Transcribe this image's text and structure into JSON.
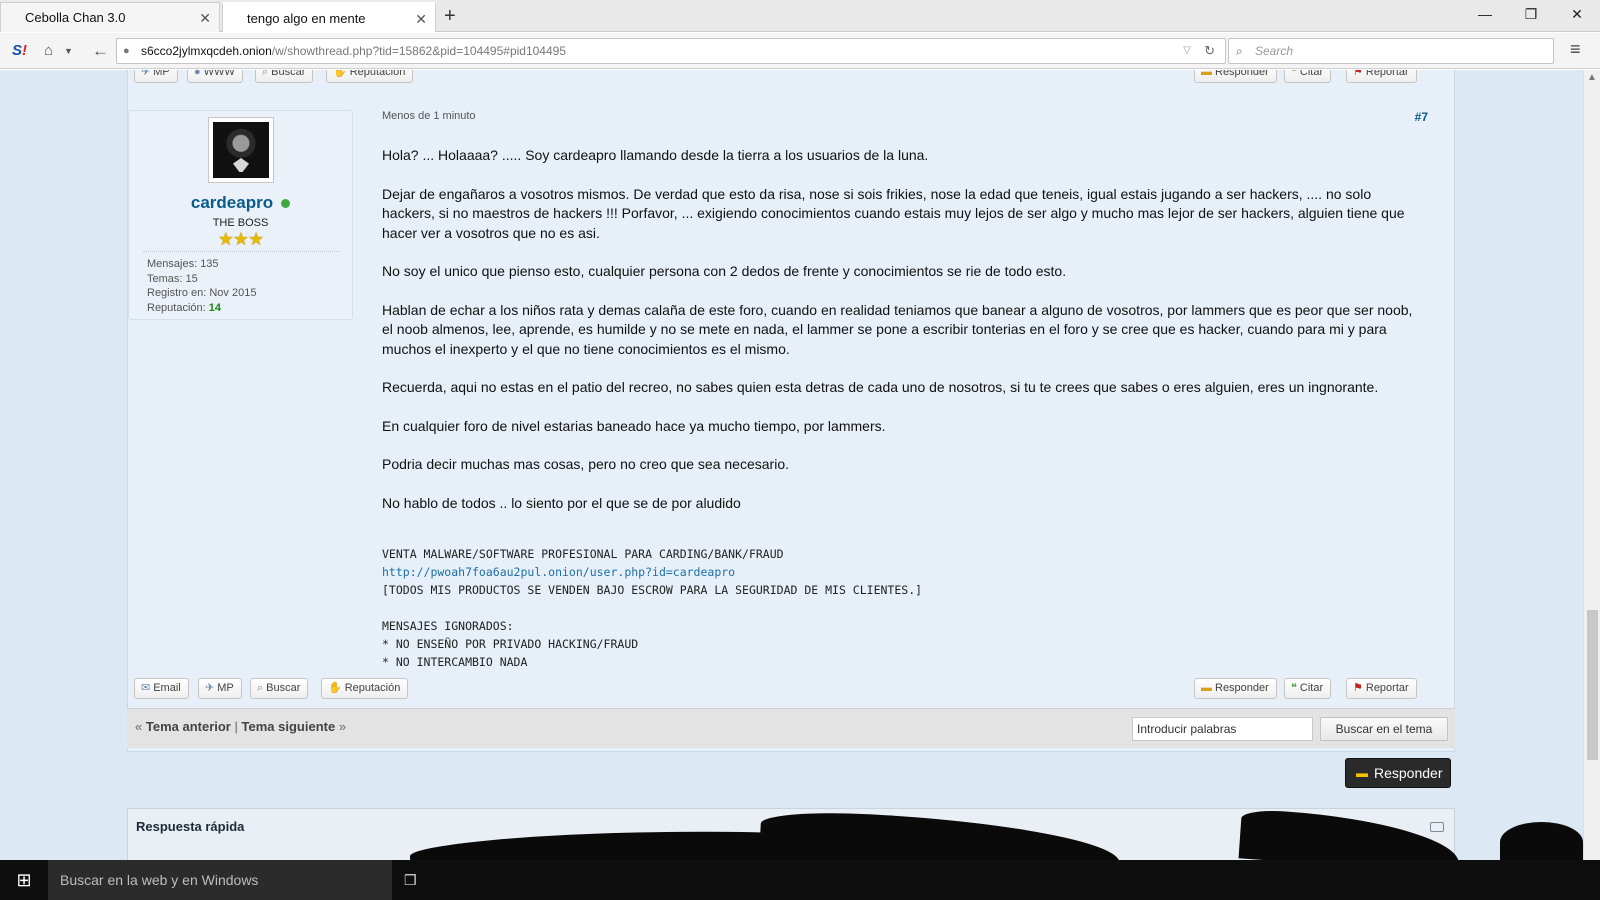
{
  "browser": {
    "tabs": [
      {
        "title": "Cebolla Chan 3.0",
        "close": "✕"
      },
      {
        "title": "tengo algo en mente",
        "close": "✕"
      }
    ],
    "new_tab": "+",
    "window_controls": {
      "minimize": "—",
      "restore": "❐",
      "close": "✕"
    },
    "url_host": "s6cco2jylmxqcdeh.onion",
    "url_path": "/w/showthread.php?tid=15862&pid=104495#pid104495",
    "search_placeholder": "Search",
    "icons": [
      "addon-s-icon",
      "home-icon",
      "back-icon",
      "lock-icon",
      "reload-icon",
      "search-icon",
      "menu-icon"
    ]
  },
  "post": {
    "top_buttons_left": [
      "MP",
      "WWW",
      "Buscar",
      "Reputación"
    ],
    "top_buttons_right": [
      "Responder",
      "Citar",
      "Reportar"
    ],
    "user": {
      "name": "cardeapro",
      "rank": "THE BOSS",
      "stars": "★★★",
      "stats": {
        "mensajes": "Mensajes: 135",
        "temas": "Temas: 15",
        "registro": "Registro en: Nov 2015",
        "reputacion_label": "Reputación:",
        "reputacion_value": "14"
      }
    },
    "time": "Menos de 1 minuto",
    "number": "#7",
    "paragraphs": [
      "Hola? ... Holaaaa? ..... Soy cardeapro llamando desde la tierra a los usuarios de la luna.",
      "Dejar de engañaros a vosotros mismos. De verdad que esto da risa, nose si sois frikies, nose la edad que teneis, igual estais jugando a ser hackers, .... no solo hackers, si no maestros de hackers !!! Porfavor, ... exigiendo conocimientos cuando estais muy lejos de ser algo y mucho mas lejor de ser hackers, alguien tiene que hacer ver a vosotros que no es asi.",
      "No soy el unico que pienso esto, cualquier persona con 2 dedos de frente y conocimientos se rie de todo esto.",
      "Hablan de echar a los niños rata y demas calaña de este foro, cuando en realidad teniamos que banear a alguno de vosotros, por lammers que es peor que ser noob, el noob almenos, lee, aprende, es humilde y no se mete en nada, el lammer se pone a escribir tonterias en el foro y se cree que es hacker, cuando para mi y para muchos el inexperto y el que no tiene conocimientos es el mismo.",
      "Recuerda, aqui no estas en el patio del recreo, no sabes quien esta detras de cada uno de nosotros, si tu te crees que sabes o eres alguien, eres un ingnorante.",
      "En cualquier foro de nivel estarias baneado hace ya mucho tiempo, por lammers.",
      "Podria decir muchas mas cosas, pero no creo que sea necesario.",
      "No hablo de todos .. lo siento por el que se de por aludido"
    ],
    "signature": {
      "line1": "VENTA MALWARE/SOFTWARE PROFESIONAL PARA CARDING/BANK/FRAUD",
      "link": "http://pwoah7foa6au2pul.onion/user.php?id=cardeapro",
      "line3": "[TODOS MIS PRODUCTOS SE VENDEN BAJO ESCROW PARA LA SEGURIDAD DE MIS CLIENTES.]",
      "line4": "MENSAJES IGNORADOS:",
      "line5": "* NO ENSEÑO POR PRIVADO HACKING/FRAUD",
      "line6": "* NO INTERCAMBIO NADA"
    },
    "bottom_buttons_left": [
      "Email",
      "MP",
      "Buscar",
      "Reputación"
    ],
    "bottom_buttons_right": [
      "Responder",
      "Citar",
      "Reportar"
    ]
  },
  "thread_nav": {
    "prev_arrow": "«",
    "prev": "Tema anterior",
    "separator": "|",
    "next": "Tema siguiente",
    "next_arrow": "»",
    "search_input_value": "Introducir palabras",
    "search_button": "Buscar en el tema"
  },
  "reply_button": "Responder",
  "quick_reply": {
    "title": "Respuesta rápida"
  },
  "taskbar": {
    "search_placeholder": "Buscar en la web y en Windows"
  },
  "colors": {
    "accent_link": "#0a5a8c",
    "page_bg": "#dce8f3",
    "post_bg": "#e7f0f8",
    "online": "#3fa83f",
    "reputation": "#188a18"
  }
}
